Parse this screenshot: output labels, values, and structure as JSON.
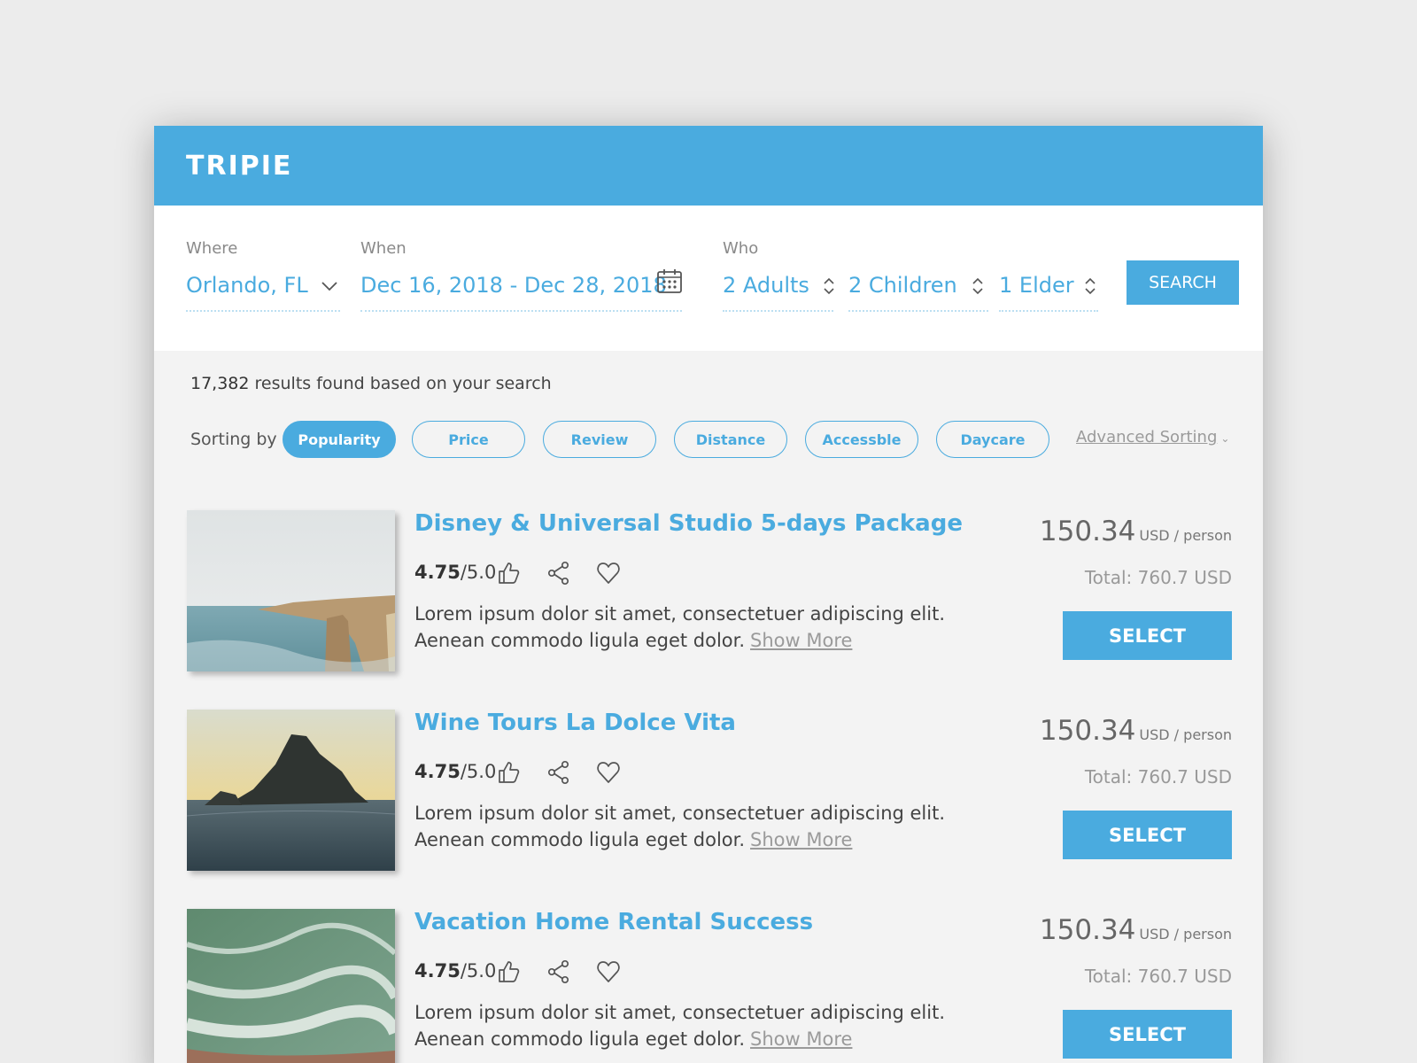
{
  "app": {
    "logo": "TRIPIE"
  },
  "search": {
    "where": {
      "label": "Where",
      "value": "Orlando, FL"
    },
    "when": {
      "label": "When",
      "value": "Dec 16, 2018 - Dec 28, 2018"
    },
    "who": {
      "label": "Who",
      "adults": "2 Adults",
      "children": "2 Children",
      "elders": "1 Elder"
    },
    "button": "SEARCH"
  },
  "results": {
    "count": "17,382",
    "suffix": " results found based on your search"
  },
  "sorting": {
    "label": "Sorting by",
    "options": [
      "Popularity",
      "Price",
      "Review",
      "Distance",
      "Accessble",
      "Daycare"
    ],
    "active": "Popularity",
    "advanced": "Advanced Sorting"
  },
  "listings": [
    {
      "title": "Disney & Universal Studio 5-days Package",
      "rating": "4.75",
      "rating_max": "/5.0",
      "description": "Lorem ipsum dolor sit amet, consectetuer adipiscing elit. Aenean commodo ligula eget dolor.",
      "show_more": "Show More",
      "price": "150.34",
      "unit": "USD / person",
      "total": "Total: 760.7 USD",
      "select": "SELECT"
    },
    {
      "title": "Wine Tours La Dolce Vita",
      "rating": "4.75",
      "rating_max": "/5.0",
      "description": "Lorem ipsum dolor sit amet, consectetuer adipiscing elit. Aenean commodo ligula eget dolor.",
      "show_more": "Show More",
      "price": "150.34",
      "unit": "USD / person",
      "total": "Total: 760.7 USD",
      "select": "SELECT"
    },
    {
      "title": "Vacation Home Rental Success",
      "rating": "4.75",
      "rating_max": "/5.0",
      "description": "Lorem ipsum dolor sit amet, consectetuer adipiscing elit. Aenean commodo ligula eget dolor.",
      "show_more": "Show More",
      "price": "150.34",
      "unit": "USD / person",
      "total": "Total: 760.7 USD",
      "select": "SELECT"
    }
  ],
  "colors": {
    "accent": "#4aabdf",
    "background": "#ececec",
    "panel": "#f3f3f3"
  },
  "icons": {
    "where": "chevron-down-icon",
    "when": "calendar-icon",
    "steppers": "up-down-stepper-icon",
    "rating": "thumbs-up-icon",
    "share": "share-icon",
    "favorite": "heart-icon"
  }
}
